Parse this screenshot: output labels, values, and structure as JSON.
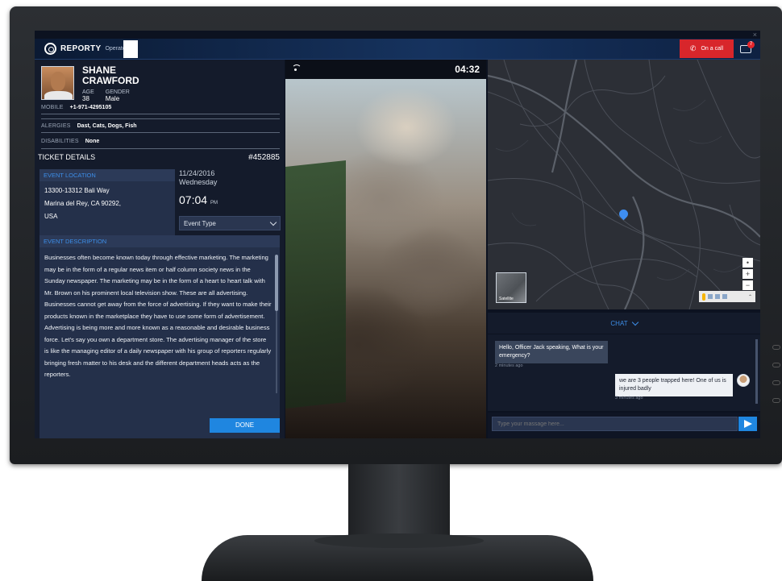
{
  "header": {
    "brand": "REPORTY",
    "role": "Operator",
    "on_call_label": "On a call",
    "notification_count": "7"
  },
  "patient": {
    "first_name": "SHANE",
    "last_name": "CRAWFORD",
    "age_label": "AGE",
    "age": "38",
    "gender_label": "GENDER",
    "gender": "Male",
    "mobile_label": "MOBILE",
    "mobile": "+1-971-4295105",
    "allergies_label": "ALERGIES",
    "allergies": "Dast, Cats, Dogs, Fish",
    "disabilities_label": "DISABILITIES",
    "disabilities": "None"
  },
  "ticket": {
    "title": "TICKET DETAILS",
    "number": "#452885",
    "location_label": "EVENT LOCATION",
    "address_line1": "13300-13312 Bali Way",
    "address_line2": "Marina del Rey, CA 90292,",
    "address_line3": "USA",
    "date": "11/24/2016",
    "weekday": "Wednesday",
    "time": "07:04",
    "meridiem": "PM",
    "event_type_placeholder": "Event Type",
    "description_label": "EVENT DESCRIPTION",
    "description": "Businesses often become known today through effective marketing. The marketing may be in the form of a regular news item or half column society news in the Sunday newspaper. The marketing may be in the form of a heart to heart talk with Mr. Brown on his prominent local television show. These are all advertising. Businesses cannot get away from the force of advertising. If they want to make their products known in the marketplace they have to use some form of advertisement. Advertising is being more and more known as a reasonable and desirable business force. Let's say you own a department store. The advertising manager of the store is like the managing editor of a daily newspaper with his group of reporters regularly bringing fresh matter to his desk and the different department heads acts as the reporters.",
    "done_label": "DONE"
  },
  "video": {
    "timer": "04:32"
  },
  "map": {
    "satellite_label": "Satellite"
  },
  "chat": {
    "title": "CHAT",
    "messages": [
      {
        "text": "Hello, Officer Jack speaking, What is your emergency?",
        "time": "2 minutes ago"
      },
      {
        "text": "we are 3 people trapped here! One of us is injured badly",
        "time": "3 minutes ago"
      }
    ],
    "input_placeholder": "Type your massage here..."
  },
  "colors": {
    "accent": "#1f86e0",
    "on_call": "#d8262b",
    "panel": "#141b2b"
  }
}
